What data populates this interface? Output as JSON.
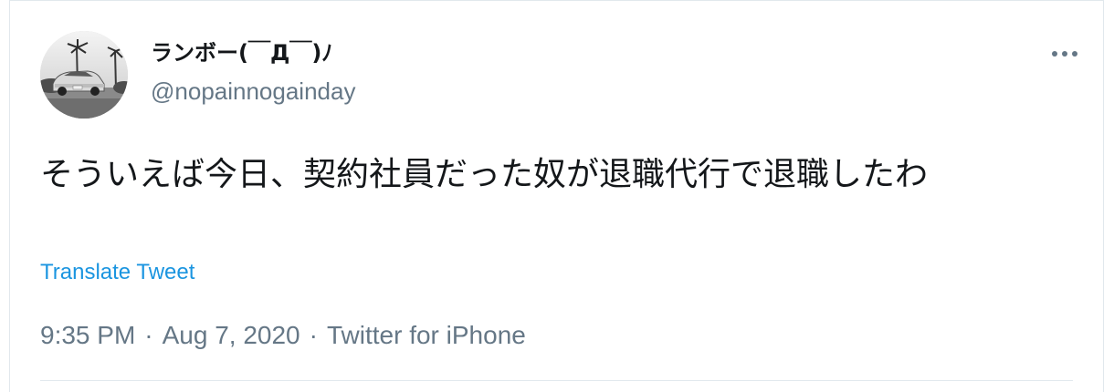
{
  "tweet": {
    "author": {
      "display_name": "ランボー(￣Д￣)ﾉ",
      "handle": "@nopainnogainday"
    },
    "text": "そういえば今日、契約社員だった奴が退職代行で退職したわ",
    "translate_label": "Translate Tweet",
    "time": "9:35 PM",
    "date": "Aug 7, 2020",
    "source": "Twitter for iPhone",
    "separator": "·"
  },
  "icons": {
    "more": "more-horizontal-icon",
    "avatar": "avatar-photo"
  },
  "colors": {
    "text_primary": "#14171a",
    "text_secondary": "#657786",
    "link": "#1b95e0",
    "border": "#e1e8ed"
  }
}
